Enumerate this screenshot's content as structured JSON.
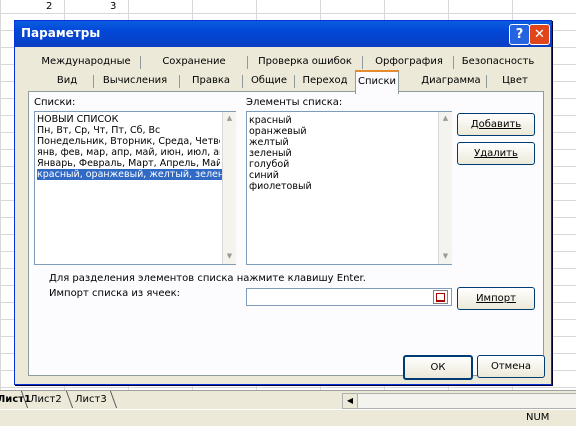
{
  "sheet": {
    "cells": [
      "2",
      "3"
    ],
    "tabs": [
      "Лист1",
      "Лист2",
      "Лист3"
    ],
    "status": "NUM"
  },
  "dialog": {
    "title": "Параметры",
    "help_icon": "?",
    "close_icon": "✕",
    "tabs_row1": [
      "Международные",
      "Сохранение",
      "Проверка ошибок",
      "Орфография",
      "Безопасность"
    ],
    "tabs_row2": [
      "Вид",
      "Вычисления",
      "Правка",
      "Общие",
      "Переход",
      "Списки",
      "Диаграмма",
      "Цвет"
    ],
    "active_tab": "Списки",
    "lists_label": "Списки:",
    "lists": [
      "НОВЫЙ СПИСОК",
      "Пн, Вт, Ср, Чт, Пт, Сб, Вс",
      "Понедельник, Вторник, Среда, Четверг,",
      "янв, фев, мар, апр, май, июн, июл, авг,",
      "Январь, Февраль, Март, Апрель, Май, И",
      "красный, оранжевый, желтый, зеленый"
    ],
    "selected_list_index": 5,
    "entries_label": "Элементы списка:",
    "entries": [
      "красный",
      "оранжевый",
      "желтый",
      "зеленый",
      "голубой",
      "синий",
      "фиолетовый"
    ],
    "add_button": "Добавить",
    "delete_button": "Удалить",
    "hint": "Для разделения элементов списка нажмите клавишу Enter.",
    "import_label": "Импорт списка из ячеек:",
    "import_value": "",
    "import_button": "Импорт",
    "ok_button": "ОК",
    "cancel_button": "Отмена"
  }
}
